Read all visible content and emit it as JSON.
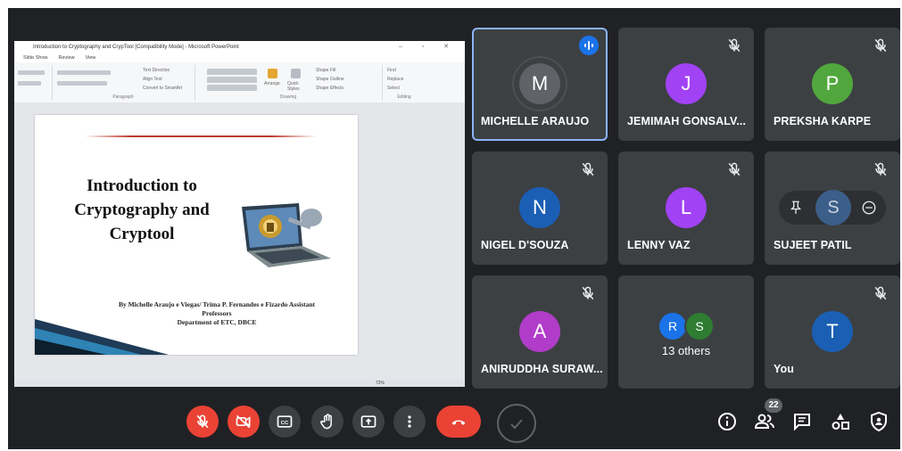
{
  "presentation": {
    "window_title": "Introduction to Cryptography and CrypTool [Compatibility Mode] - Microsoft PowerPoint",
    "ribbon_tabs": [
      "Slide Show",
      "Review",
      "View"
    ],
    "ribbon_groups": {
      "paragraph": "Paragraph",
      "drawing": "Drawing",
      "editing": "Editing"
    },
    "ribbon_buttons": {
      "text_direction": "Text Direction",
      "align_text": "Align Text",
      "convert_smartart": "Convert to SmartArt",
      "arrange": "Arrange",
      "quick_styles": "Quick Styles",
      "shape_fill": "Shape Fill",
      "shape_outline": "Shape Outline",
      "shape_effects": "Shape Effects",
      "find": "Find",
      "replace": "Replace",
      "select": "Select"
    },
    "slide": {
      "title_lines": [
        "Introduction to",
        "Cryptography and",
        "Cryptool"
      ],
      "byline_lines": [
        "By Michelle Araujo e Viegas/ Trima P. Fernandes e Fizardo Assistant",
        "Professors",
        "Department of ETC, DBCE"
      ]
    },
    "zoom": "72%"
  },
  "participants": [
    {
      "name": "MICHELLE ARAUJO",
      "initial": "M",
      "color": "#5f6368",
      "speaking": true
    },
    {
      "name": "JEMIMAH GONSALV...",
      "initial": "J",
      "color": "#a142f4",
      "muted": true
    },
    {
      "name": "PREKSHA KARPE",
      "initial": "P",
      "color": "#51a73d",
      "muted": true
    },
    {
      "name": "NIGEL D'SOUZA",
      "initial": "N",
      "color": "#1a5fb4",
      "muted": true
    },
    {
      "name": "LENNY VAZ",
      "initial": "L",
      "color": "#a142f4",
      "muted": true
    },
    {
      "name": "SUJEET PATIL",
      "initial": "S",
      "color": "#3c5f8a",
      "muted": true
    },
    {
      "name": "ANIRUDDHA SURAW...",
      "initial": "A",
      "color": "#b13cc9",
      "muted": true
    },
    {
      "others_label": "13 others",
      "initials": [
        "R",
        "S"
      ],
      "colors": [
        "#1a73e8",
        "#2e7d32"
      ]
    },
    {
      "name": "You",
      "initial": "T",
      "color": "#1a5fb4",
      "muted": true
    }
  ],
  "controls": {
    "people_count": "22"
  },
  "icons": {
    "mic": "mic-off-icon",
    "camera": "camera-off-icon",
    "captions": "closed-caption-icon",
    "hand": "raise-hand-icon",
    "present": "present-screen-icon",
    "more": "more-vert-icon",
    "end": "end-call-icon",
    "info": "info-icon",
    "people": "people-icon",
    "chat": "chat-icon",
    "activities": "activities-icon",
    "host": "host-controls-icon"
  }
}
